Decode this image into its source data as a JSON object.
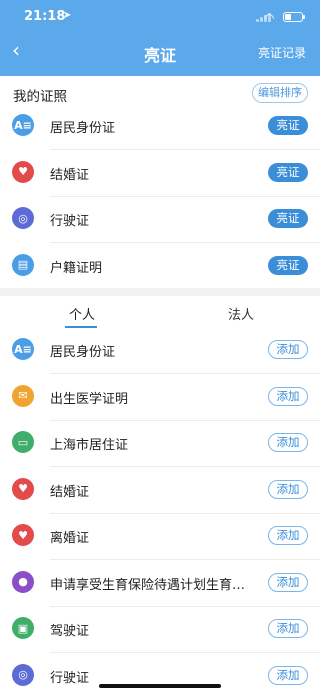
{
  "status_bar": {
    "time": "21:18",
    "location_icon": "location-arrow-icon"
  },
  "nav": {
    "back_icon": "chevron-left-icon",
    "title": "亮证",
    "record_label": "亮证记录"
  },
  "my_certificates": {
    "title": "我的证照",
    "edit_label": "编辑排序",
    "items": [
      {
        "label": "居民身份证",
        "action": "亮证",
        "icon": "id-card-icon",
        "color": "#4a9de6"
      },
      {
        "label": "结婚证",
        "action": "亮证",
        "icon": "marriage-icon",
        "color": "#e34b4b"
      },
      {
        "label": "行驶证",
        "action": "亮证",
        "icon": "steering-wheel-icon",
        "color": "#5c6bd6"
      },
      {
        "label": "户籍证明",
        "action": "亮证",
        "icon": "household-register-icon",
        "color": "#4a9de6"
      }
    ]
  },
  "tabs": {
    "personal": "个人",
    "legal": "法人"
  },
  "add_list": [
    {
      "label": "居民身份证",
      "action": "添加",
      "icon": "id-card-icon",
      "color": "#4a9de6"
    },
    {
      "label": "出生医学证明",
      "action": "添加",
      "icon": "birth-certificate-icon",
      "color": "#f0a32e"
    },
    {
      "label": "上海市居住证",
      "action": "添加",
      "icon": "residence-permit-icon",
      "color": "#3fae6a"
    },
    {
      "label": "结婚证",
      "action": "添加",
      "icon": "marriage-icon",
      "color": "#e34b4b"
    },
    {
      "label": "离婚证",
      "action": "添加",
      "icon": "broken-heart-icon",
      "color": "#e34b4b"
    },
    {
      "label": "申请享受生育保险待遇计划生育情况证明",
      "action": "添加",
      "icon": "maternity-icon",
      "color": "#8a4fc9"
    },
    {
      "label": "驾驶证",
      "action": "添加",
      "icon": "driving-license-icon",
      "color": "#3fae6a"
    },
    {
      "label": "行驶证",
      "action": "添加",
      "icon": "steering-wheel-icon",
      "color": "#5c6bd6"
    }
  ]
}
